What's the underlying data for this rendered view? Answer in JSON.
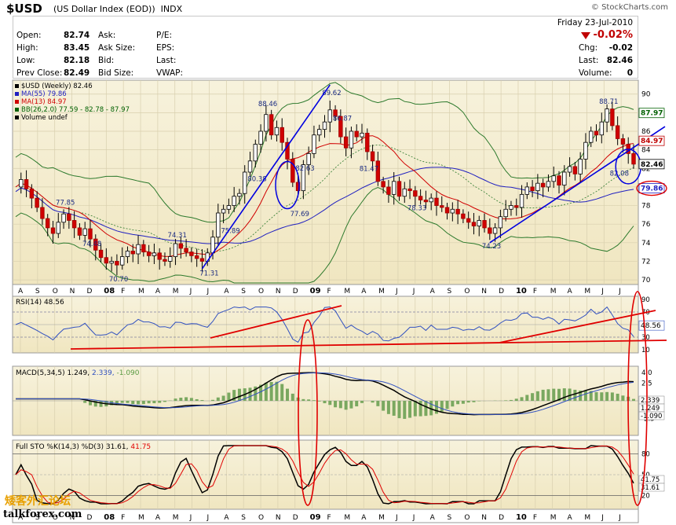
{
  "header": {
    "symbol": "$USD",
    "name": "(US Dollar Index (EOD))",
    "exchange": "INDX",
    "copyright": "© StockCharts.com"
  },
  "quote": {
    "date": "Friday   23-Jul-2010",
    "change_pct": "-0.02%",
    "fields_left": [
      {
        "label": "Open:",
        "value": "82.74"
      },
      {
        "label": "High:",
        "value": "83.45"
      },
      {
        "label": "Low:",
        "value": "82.18"
      },
      {
        "label": "Prev Close:",
        "value": "82.49"
      }
    ],
    "fields_mid": [
      "Ask:",
      "Ask Size:",
      "Bid:",
      "Bid Size:"
    ],
    "fields_right": [
      "P/E:",
      "EPS:",
      "Last:",
      "VWAP:"
    ],
    "fields_far": [
      {
        "label": "Chg:",
        "value": "-0.02"
      },
      {
        "label": "Last:",
        "value": "82.46"
      },
      {
        "label": "Volume:",
        "value": "0"
      }
    ]
  },
  "main_legend": [
    {
      "text": "$USD (Weekly) 82.46",
      "color": "#000000"
    },
    {
      "text": "MA(55) 79.86",
      "color": "#2020c0"
    },
    {
      "text": "MA(13) 84.97",
      "color": "#d00000"
    },
    {
      "text": "BB(26,2.0) 77.59 - 82.78 - 87.97",
      "color": "#006000"
    },
    {
      "text": "Volume undef",
      "color": "#000000"
    }
  ],
  "rsi_legend": "RSI(14) 48.56",
  "macd_legend": {
    "a": "MACD(5,34,5) 1.249,",
    "b": "2.339,",
    "c": "-1.090"
  },
  "sto_legend": {
    "a": "Full STO %K(14,3) %D(3) 31.61,",
    "b": "41.75"
  },
  "chart_data": {
    "type": "candlestick",
    "interval": "weekly",
    "x_months": [
      "A",
      "S",
      "O",
      "N",
      "D",
      "08",
      "F",
      "M",
      "A",
      "M",
      "J",
      "J",
      "A",
      "S",
      "O",
      "N",
      "D",
      "09",
      "F",
      "M",
      "A",
      "M",
      "J",
      "J",
      "A",
      "S",
      "O",
      "N",
      "D",
      "10",
      "F",
      "M",
      "A",
      "M",
      "J",
      "J"
    ],
    "y_ticks": [
      70,
      72,
      74,
      76,
      78,
      80,
      82,
      84,
      86,
      88,
      90
    ],
    "ylim": [
      69.5,
      91.5
    ],
    "price_path": [
      [
        0,
        80.0
      ],
      [
        1,
        80.8
      ],
      [
        2,
        79.8
      ],
      [
        3,
        78.8
      ],
      [
        4,
        77.8
      ],
      [
        5,
        76.6
      ],
      [
        6,
        75.6
      ],
      [
        7,
        75.0
      ],
      [
        8,
        76.2
      ],
      [
        9,
        77.1
      ],
      [
        10,
        76.4
      ],
      [
        11,
        75.6
      ],
      [
        12,
        74.8
      ],
      [
        13,
        75.5
      ],
      [
        14,
        74.4
      ],
      [
        15,
        73.2
      ],
      [
        16,
        72.4
      ],
      [
        17,
        71.8
      ],
      [
        18,
        72.0
      ],
      [
        19,
        71.6
      ],
      [
        20,
        72.5
      ],
      [
        21,
        73.1
      ],
      [
        22,
        72.8
      ],
      [
        23,
        73.8
      ],
      [
        24,
        73.0
      ],
      [
        25,
        72.6
      ],
      [
        26,
        72.9
      ],
      [
        27,
        72.2
      ],
      [
        28,
        72.0
      ],
      [
        29,
        72.5
      ],
      [
        30,
        73.9
      ],
      [
        31,
        73.4
      ],
      [
        32,
        73.0
      ],
      [
        33,
        72.6
      ],
      [
        34,
        72.3
      ],
      [
        35,
        72.0
      ],
      [
        36,
        72.9
      ],
      [
        37,
        74.6
      ],
      [
        38,
        77.2
      ],
      [
        39,
        77.6
      ],
      [
        40,
        78.0
      ],
      [
        41,
        79.0
      ],
      [
        42,
        79.3
      ],
      [
        43,
        81.6
      ],
      [
        44,
        82.8
      ],
      [
        45,
        84.6
      ],
      [
        46,
        86.0
      ],
      [
        47,
        87.8
      ],
      [
        48,
        85.6
      ],
      [
        49,
        86.4
      ],
      [
        50,
        84.8
      ],
      [
        51,
        83.0
      ],
      [
        52,
        80.5
      ],
      [
        53,
        79.6
      ],
      [
        54,
        82.4
      ],
      [
        55,
        83.6
      ],
      [
        56,
        85.6
      ],
      [
        57,
        86.2
      ],
      [
        58,
        87.0
      ],
      [
        59,
        88.3
      ],
      [
        60,
        87.6
      ],
      [
        61,
        85.4
      ],
      [
        62,
        84.2
      ],
      [
        63,
        86.0
      ],
      [
        64,
        85.4
      ],
      [
        65,
        85.8
      ],
      [
        66,
        83.8
      ],
      [
        67,
        82.8
      ],
      [
        68,
        80.6
      ],
      [
        69,
        80.0
      ],
      [
        70,
        79.2
      ],
      [
        71,
        80.6
      ],
      [
        72,
        79.0
      ],
      [
        73,
        79.8
      ],
      [
        74,
        79.6
      ],
      [
        75,
        79.0
      ],
      [
        76,
        78.6
      ],
      [
        77,
        78.4
      ],
      [
        78,
        78.8
      ],
      [
        79,
        78.0
      ],
      [
        80,
        77.8
      ],
      [
        81,
        77.2
      ],
      [
        82,
        77.6
      ],
      [
        83,
        77.1
      ],
      [
        84,
        76.6
      ],
      [
        85,
        76.2
      ],
      [
        86,
        75.8
      ],
      [
        87,
        76.4
      ],
      [
        88,
        75.6
      ],
      [
        89,
        75.0
      ],
      [
        90,
        75.6
      ],
      [
        91,
        76.8
      ],
      [
        92,
        77.6
      ],
      [
        93,
        78.0
      ],
      [
        94,
        77.8
      ],
      [
        95,
        79.2
      ],
      [
        96,
        80.0
      ],
      [
        97,
        79.6
      ],
      [
        98,
        80.4
      ],
      [
        99,
        80.0
      ],
      [
        100,
        80.6
      ],
      [
        101,
        81.2
      ],
      [
        102,
        80.2
      ],
      [
        103,
        81.6
      ],
      [
        104,
        82.2
      ],
      [
        105,
        81.4
      ],
      [
        106,
        83.0
      ],
      [
        107,
        84.8
      ],
      [
        108,
        86.0
      ],
      [
        109,
        85.6
      ],
      [
        110,
        87.0
      ],
      [
        111,
        88.4
      ],
      [
        112,
        86.6
      ],
      [
        113,
        85.2
      ],
      [
        114,
        84.6
      ],
      [
        115,
        83.6
      ],
      [
        116,
        82.46
      ]
    ],
    "annotations": [
      "88.46",
      "80.38",
      "77.85",
      "74.48",
      "70.70",
      "74.31",
      "71.31",
      "75.89",
      "77.69",
      "89.62",
      "86.87",
      "82.63",
      "81.47",
      "78.33",
      "74.23",
      "88.71",
      "82.08"
    ],
    "right_labels": {
      "bb_upper": "87.97",
      "ma13": "84.97",
      "last": "82.46",
      "bb_mid": "82.78",
      "ma55": "79.86",
      "bb_lower": "77.59"
    },
    "rsi": {
      "ticks": [
        "90",
        "70",
        "50",
        "30",
        "10"
      ],
      "value_label": "48.56",
      "levels": [
        70,
        30
      ]
    },
    "macd": {
      "ticks": [
        "4.0",
        "2.5",
        "0.0",
        "-2.5"
      ],
      "labels": [
        "2.339",
        "1.249",
        "-1.090"
      ]
    },
    "sto": {
      "ticks": [
        "80",
        "50",
        "20"
      ],
      "labels": [
        "41.75",
        "31.61"
      ]
    },
    "bottom_months": [
      "A",
      "S",
      "O",
      "N",
      "D",
      "08",
      "F",
      "M",
      "A",
      "M",
      "J",
      "J",
      "A",
      "S",
      "O",
      "N",
      "D",
      "09",
      "F",
      "M",
      "A",
      "M",
      "J",
      "J",
      "A",
      "S",
      "O",
      "N",
      "D",
      "10",
      "F",
      "M",
      "A",
      "M",
      "J",
      "J"
    ]
  },
  "watermark": {
    "cn": "矮客外汇论坛",
    "en": "talkforex.com"
  }
}
